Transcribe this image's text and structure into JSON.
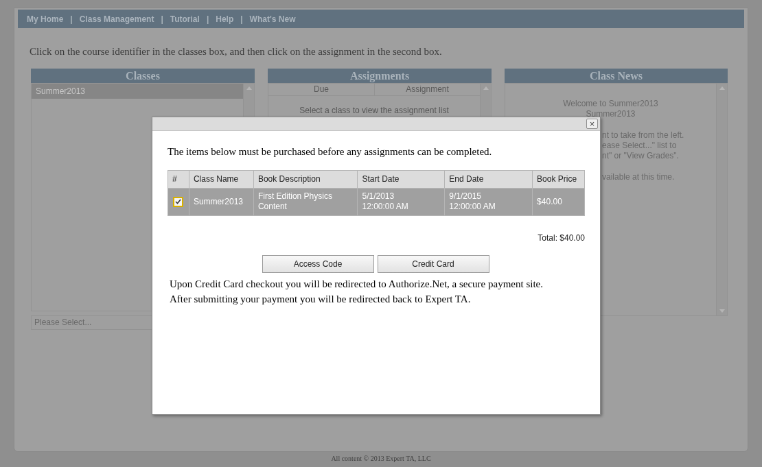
{
  "nav": [
    {
      "label": "My Home"
    },
    {
      "label": "Class Management"
    },
    {
      "label": "Tutorial"
    },
    {
      "label": "Help"
    },
    {
      "label": "What's New"
    }
  ],
  "nav_separator": "|",
  "instruction": "Click on the course identifier in the classes box, and then click on the assignment in the second box.",
  "classes": {
    "title": "Classes",
    "items": [
      {
        "label": "Summer2013",
        "selected": true
      }
    ],
    "select": {
      "value": "Please Select..."
    }
  },
  "assignments": {
    "title": "Assignments",
    "columns": [
      "Due",
      "Assignment"
    ],
    "message": "Select a class to view the assignment list"
  },
  "class_news": {
    "title": "Class News",
    "lines": [
      "Welcome to Summer2013",
      "Summer2013"
    ],
    "partial_lines": [
      "nt to take from the left.",
      "ease Select...\" list to",
      "nt\" or \"View Grades\"."
    ],
    "partial_note": "vailable at this time."
  },
  "footer": "All content © 2013 Expert TA, LLC",
  "dialog": {
    "close": "×",
    "intro": "The items below must be purchased before any assignments can be completed.",
    "columns": [
      "#",
      "Class Name",
      "Book Description",
      "Start Date",
      "End Date",
      "Book Price"
    ],
    "rows": [
      {
        "checked": true,
        "class_name": "Summer2013",
        "book_description": "First Edition Physics Content",
        "start_date": "5/1/2013 12:00:00 AM",
        "end_date": "9/1/2015 12:00:00 AM",
        "book_price": "$40.00"
      }
    ],
    "total": "Total: $40.00",
    "buttons": [
      "Access Code",
      "Credit Card"
    ],
    "notes": [
      "Upon Credit Card checkout you will be redirected to Authorize.Net, a secure payment site.",
      "After submitting your payment you will be redirected back to Expert TA."
    ]
  }
}
